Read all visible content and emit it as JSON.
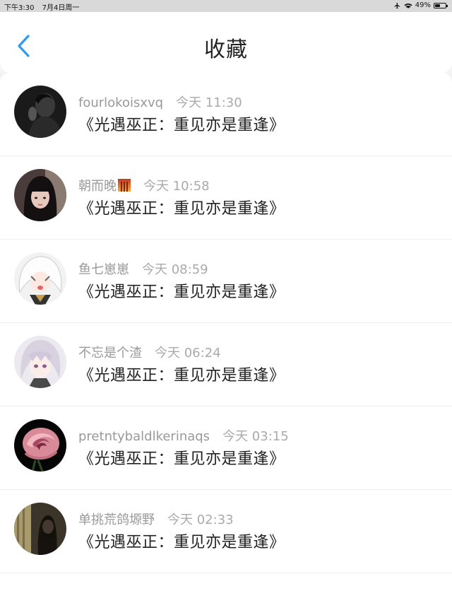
{
  "status_bar": {
    "time": "下午3:30",
    "date": "7月4日周一",
    "battery_percent": "49%",
    "battery_level": 0.49,
    "icons": [
      "airplane-icon",
      "wifi-icon",
      "battery-icon"
    ]
  },
  "nav": {
    "title": "收藏",
    "back_icon": "chevron-left-icon",
    "accent_color": "#2e9bf0"
  },
  "favorites": [
    {
      "username": "fourlokoisxvq",
      "time": "今天 11:30",
      "title": "《光遇巫正：重见亦是重逢》",
      "avatar": "dark-photo"
    },
    {
      "username": "朝而晚",
      "has_emoji": true,
      "time": "今天 10:58",
      "title": "《光遇巫正：重见亦是重逢》",
      "avatar": "girl-photo"
    },
    {
      "username": "鱼七崽崽",
      "time": "今天 08:59",
      "title": "《光遇巫正：重见亦是重逢》",
      "avatar": "anime-white"
    },
    {
      "username": "不忘是个渣",
      "time": "今天 06:24",
      "title": "《光遇巫正：重见亦是重逢》",
      "avatar": "anime-gray"
    },
    {
      "username": "pretntybaldlkerinaqs",
      "time": "今天 03:15",
      "title": "《光遇巫正：重见亦是重逢》",
      "avatar": "rose"
    },
    {
      "username": "单挑荒鸽塬野",
      "time": "今天 02:33",
      "title": "《光遇巫正：重见亦是重逢》",
      "avatar": "dim-photo"
    }
  ]
}
